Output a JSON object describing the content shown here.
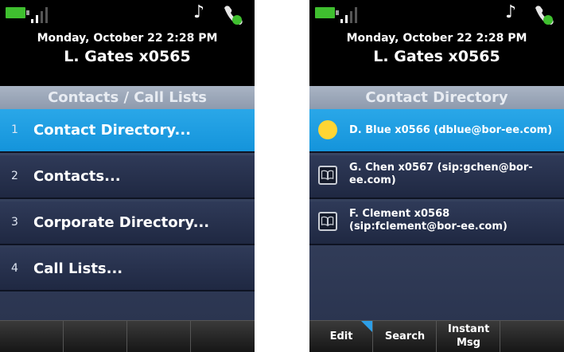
{
  "screens": {
    "left": {
      "header": {
        "date": "Monday, October 22 2:28 PM",
        "user": "L. Gates x0565"
      },
      "title": "Contacts / Call Lists",
      "menu": [
        {
          "num": "1",
          "label": "Contact Directory...",
          "selected": true
        },
        {
          "num": "2",
          "label": "Contacts...",
          "selected": false
        },
        {
          "num": "3",
          "label": "Corporate Directory...",
          "selected": false
        },
        {
          "num": "4",
          "label": "Call Lists...",
          "selected": false
        }
      ],
      "softkeys": [
        "",
        "",
        "",
        ""
      ]
    },
    "right": {
      "header": {
        "date": "Monday, October 22 2:28 PM",
        "user": "L. Gates x0565"
      },
      "title": "Contact Directory",
      "contacts": [
        {
          "label": "D. Blue x0566 (dblue@bor-ee.com)",
          "icon": "presence-online-icon",
          "selected": true
        },
        {
          "label": "G. Chen x0567 (sip:gchen@bor-ee.com)",
          "icon": "directory-book-icon",
          "selected": false
        },
        {
          "label": "F. Clement x0568 (sip:fclement@bor-ee.com)",
          "icon": "directory-book-icon",
          "selected": false
        }
      ],
      "softkeys": [
        "Edit",
        "Search",
        "Instant Msg",
        ""
      ]
    }
  },
  "colors": {
    "selection": "#1a9de0",
    "list_background": "#2a3452",
    "title_bar": "#9aa6b8",
    "battery": "#3fbf2f",
    "presence": "#ffd534"
  }
}
